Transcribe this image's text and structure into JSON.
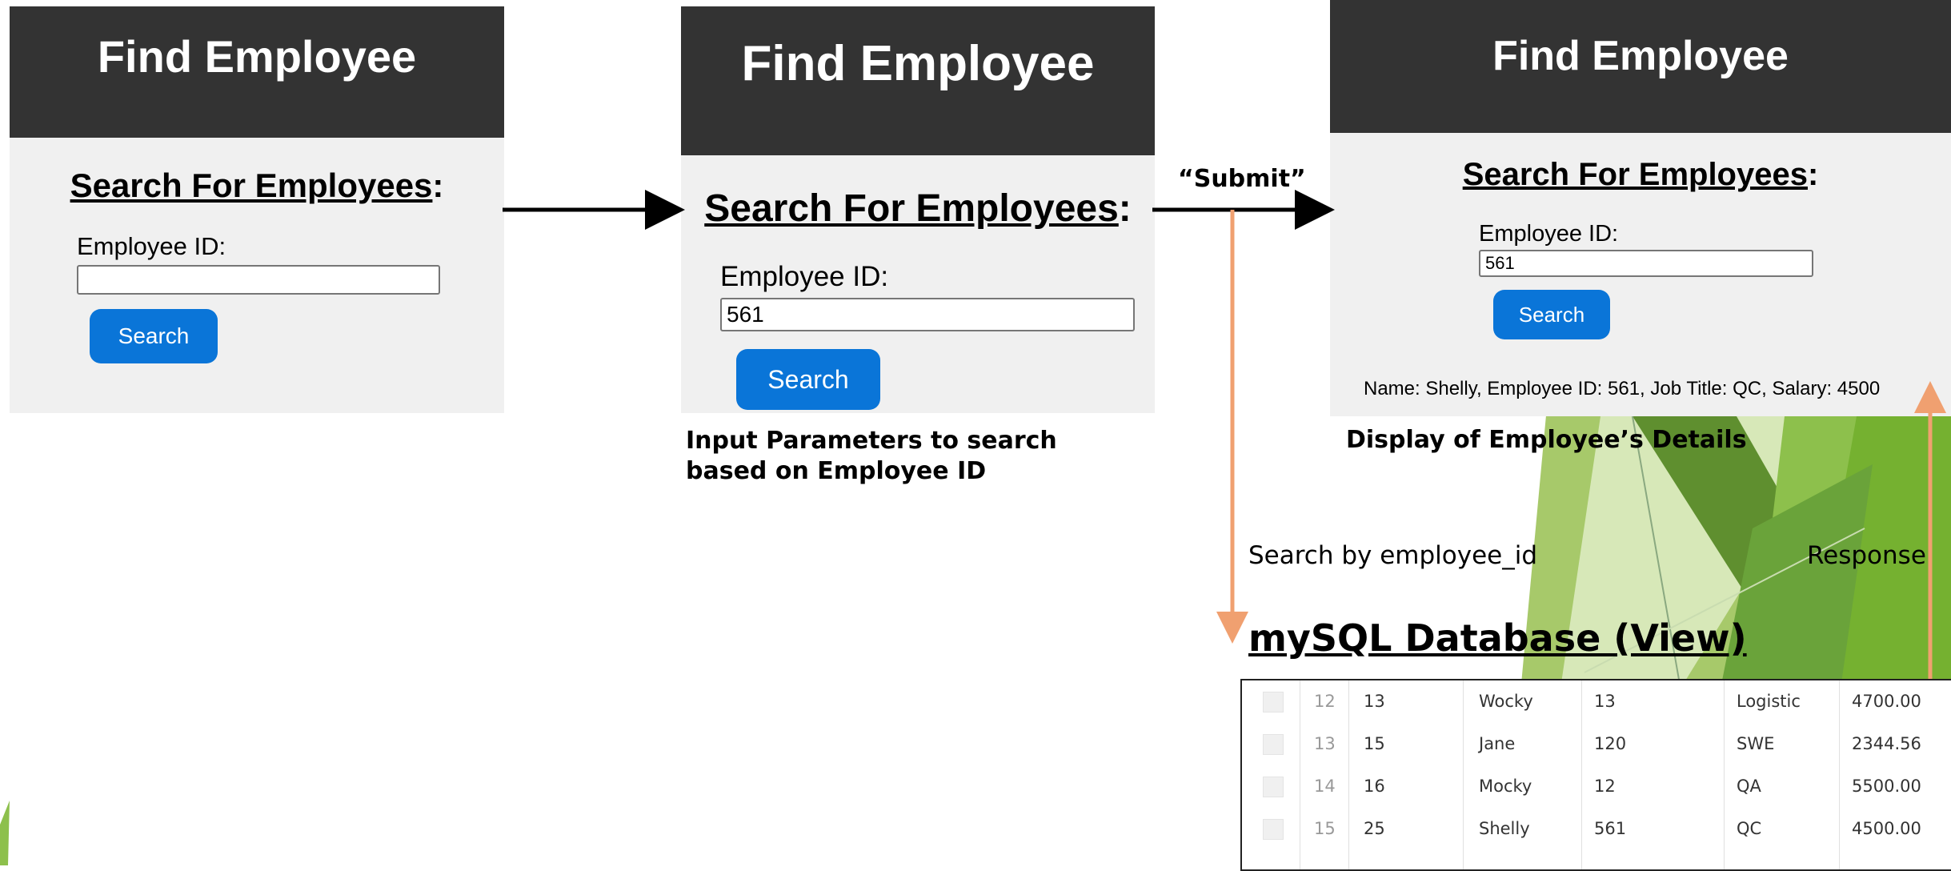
{
  "colors": {
    "header_bg": "#333333",
    "panel_bg": "#f0f0f0",
    "button": "#0a75d8",
    "db_arrow": "#f0a070",
    "accent_green": "#7cb342"
  },
  "panel1": {
    "title": "Find Employee",
    "heading": "Search For Employees",
    "colon": ":",
    "field_label": "Employee ID:",
    "field_value": "",
    "button": "Search"
  },
  "panel2": {
    "title": "Find Employee",
    "heading": "Search For Employees",
    "colon": ":",
    "field_label": "Employee ID:",
    "field_value": "561",
    "button": "Search"
  },
  "panel3": {
    "title": "Find Employee",
    "heading": "Search For Employees",
    "colon": ":",
    "field_label": "Employee ID:",
    "field_value": "561",
    "button": "Search",
    "result": "Name: Shelly, Employee ID: 561, Job Title: QC, Salary: 4500"
  },
  "labels": {
    "submit": "“Submit”",
    "input_caption": "Input Parameters to search based on Employee ID",
    "display_caption": "Display of Employee’s Details",
    "search_by": "Search by employee_id",
    "response": "Response",
    "db_title": "mySQL Database (View)"
  },
  "db_rows": [
    {
      "idx": "12",
      "id": "13",
      "name": "Wocky",
      "emp_id": "13",
      "title": "Logistic",
      "salary": "4700.00"
    },
    {
      "idx": "13",
      "id": "15",
      "name": "Jane",
      "emp_id": "120",
      "title": "SWE",
      "salary": "2344.56"
    },
    {
      "idx": "14",
      "id": "16",
      "name": "Mocky",
      "emp_id": "12",
      "title": "QA",
      "salary": "5500.00"
    },
    {
      "idx": "15",
      "id": "25",
      "name": "Shelly",
      "emp_id": "561",
      "title": "QC",
      "salary": "4500.00"
    }
  ]
}
